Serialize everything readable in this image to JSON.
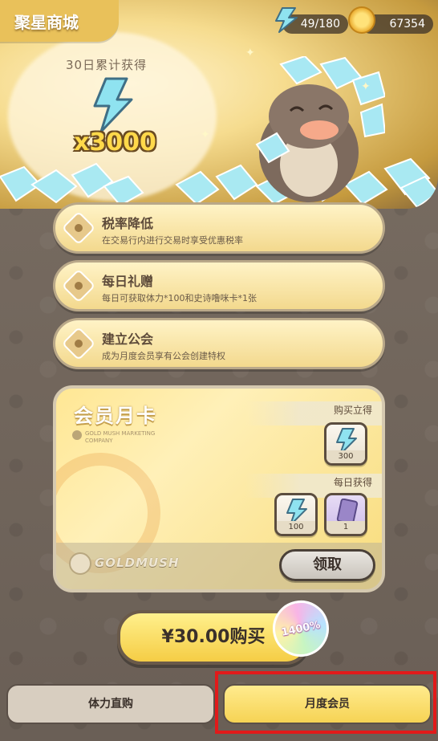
{
  "header": {
    "title": "聚星商城",
    "energy": "49/180",
    "coins": "67354"
  },
  "hero": {
    "accum_label": "30日累计获得",
    "amount": "x3000"
  },
  "perks": [
    {
      "title": "税率降低",
      "desc": "在交易行内进行交易时享受优惠税率"
    },
    {
      "title": "每日礼赠",
      "desc": "每日可获取体力*100和史诗噜咪卡*1张"
    },
    {
      "title": "建立公会",
      "desc": "成为月度会员享有公会创建特权"
    }
  ],
  "card": {
    "title": "会员月卡",
    "brand_sub": "GOLD MUSH MARKETING COMPANY",
    "buy_label": "购买立得",
    "buy_reward_count": "300",
    "daily_label": "每日获得",
    "daily_reward_counts": [
      "100",
      "1"
    ],
    "logo_text": "GOLDMUSH",
    "claim_label": "领取"
  },
  "purchase": {
    "price_label": "¥30.00购买",
    "badge": "1400%"
  },
  "tabs": [
    {
      "label": "体力直购"
    },
    {
      "label": "月度会员"
    }
  ],
  "colors": {
    "accent_yellow": "#f6d354",
    "highlight_red": "#e11a1a",
    "energy_cyan": "#7fd8e8"
  }
}
